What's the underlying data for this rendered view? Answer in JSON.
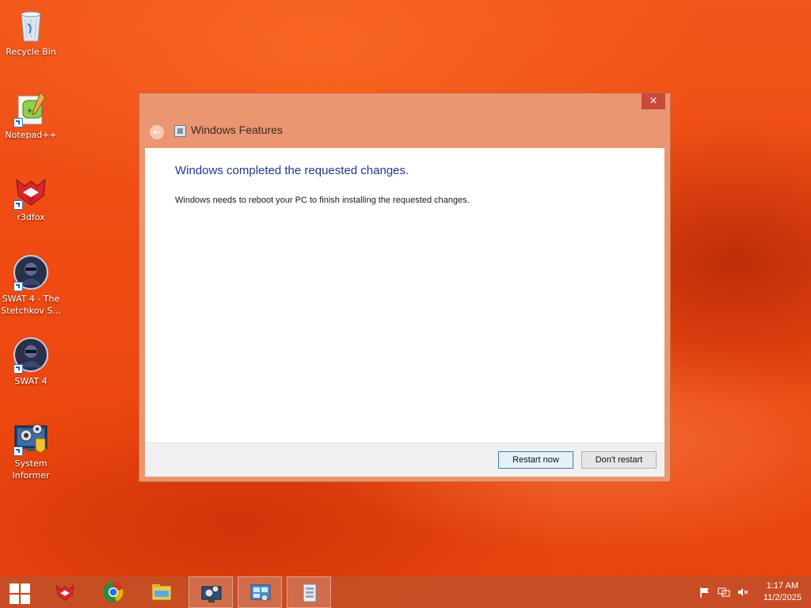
{
  "desktop": {
    "icons": [
      {
        "label": "Recycle Bin"
      },
      {
        "label": "Notepad++"
      },
      {
        "label": "r3dfox"
      },
      {
        "label": "SWAT 4 - The Stetchkov S..."
      },
      {
        "label": "SWAT 4"
      },
      {
        "label": "System Informer"
      }
    ]
  },
  "window": {
    "title": "Windows Features",
    "close_glyph": "×",
    "back_glyph": "←",
    "heading": "Windows completed the requested changes.",
    "message": "Windows needs to reboot your PC to finish installing the requested changes.",
    "buttons": {
      "restart": "Restart now",
      "dont_restart": "Don't restart"
    }
  },
  "taskbar": {
    "items": [
      {
        "icon": "start-icon"
      },
      {
        "icon": "r3dfox-icon"
      },
      {
        "icon": "chrome-icon"
      },
      {
        "icon": "file-explorer-icon"
      },
      {
        "icon": "system-settings-icon",
        "active": true
      },
      {
        "icon": "control-panel-icon",
        "active": true
      },
      {
        "icon": "windows-features-icon",
        "active": true
      }
    ],
    "tray": {
      "time": "1:17 AM",
      "date": "11/2/2025"
    }
  },
  "colors": {
    "accent": "#ea9670",
    "heading": "#1e3a8a",
    "close": "#c74a3a"
  }
}
